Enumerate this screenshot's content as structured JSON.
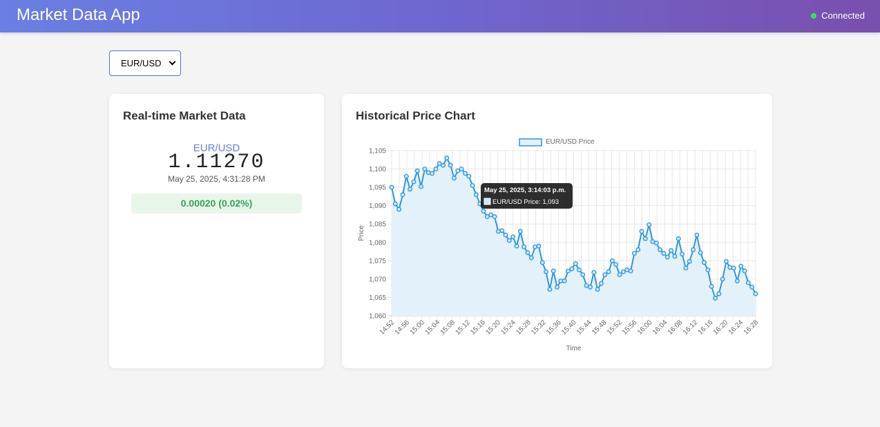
{
  "header": {
    "title": "Market Data App",
    "status": "Connected",
    "status_color": "#3ee05a"
  },
  "pair_select": {
    "value": "EUR/USD"
  },
  "market_card": {
    "title": "Real-time Market Data",
    "pair": "EUR/USD",
    "price": "1.11270",
    "timestamp": "May 25, 2025, 4:31:28 PM",
    "change": "0.00020 (0.02%)"
  },
  "chart_card": {
    "title": "Historical Price Chart"
  },
  "chart_data": {
    "type": "line",
    "title": "",
    "legend": "EUR/USD Price",
    "legend_position": "top",
    "xlabel": "Time",
    "ylabel": "Price",
    "ylim": [
      1.06,
      1.105
    ],
    "y_ticks": [
      "1,060",
      "1,065",
      "1,070",
      "1,075",
      "1,080",
      "1,085",
      "1,090",
      "1,095",
      "1,100",
      "1,105"
    ],
    "x_ticks": [
      "14:52",
      "14:56",
      "15:00",
      "15:04",
      "15:08",
      "15:12",
      "15:16",
      "15:20",
      "15:24",
      "15:28",
      "15:32",
      "15:36",
      "15:40",
      "15:44",
      "15:48",
      "15:52",
      "15:56",
      "16:00",
      "16:04",
      "16:08",
      "16:12",
      "16:16",
      "16:20",
      "16:24",
      "16:28"
    ],
    "grid": true,
    "line_color": "#2b95e0",
    "fill_color": "#e3f1fb",
    "series": [
      {
        "name": "EUR/USD Price",
        "values": [
          1.095,
          1.0905,
          1.089,
          1.093,
          1.098,
          1.0945,
          1.0965,
          1.0995,
          1.0952,
          1.1,
          1.099,
          1.0988,
          1.1,
          1.1015,
          1.101,
          1.103,
          1.101,
          1.0975,
          1.0995,
          1.1,
          1.0988,
          1.098,
          1.0955,
          1.093,
          1.0905,
          1.0885,
          1.087,
          1.0875,
          1.087,
          1.083,
          1.0832,
          1.082,
          1.0805,
          1.0815,
          1.079,
          1.083,
          1.0788,
          1.0772,
          1.0758,
          1.0788,
          1.079,
          1.0745,
          1.072,
          1.0672,
          1.0722,
          1.0678,
          1.0695,
          1.0695,
          1.0722,
          1.0728,
          1.0742,
          1.0725,
          1.0712,
          1.0682,
          1.0678,
          1.0718,
          1.0672,
          1.0688,
          1.0712,
          1.072,
          1.075,
          1.074,
          1.0712,
          1.072,
          1.0725,
          1.0722,
          1.077,
          1.078,
          1.083,
          1.081,
          1.0848,
          1.0802,
          1.0798,
          1.078,
          1.077,
          1.076,
          1.0778,
          1.0762,
          1.081,
          1.0768,
          1.073,
          1.0748,
          1.078,
          1.082,
          1.0772,
          1.0745,
          1.0725,
          1.068,
          1.0648,
          1.066,
          1.07,
          1.0748,
          1.0732,
          1.073,
          1.0695,
          1.0735,
          1.0722,
          1.069,
          1.0678,
          1.066
        ]
      }
    ],
    "tooltip": {
      "title": "May 25, 2025, 3:14:03 p.m.",
      "label": "EUR/USD Price: 1,093"
    }
  }
}
